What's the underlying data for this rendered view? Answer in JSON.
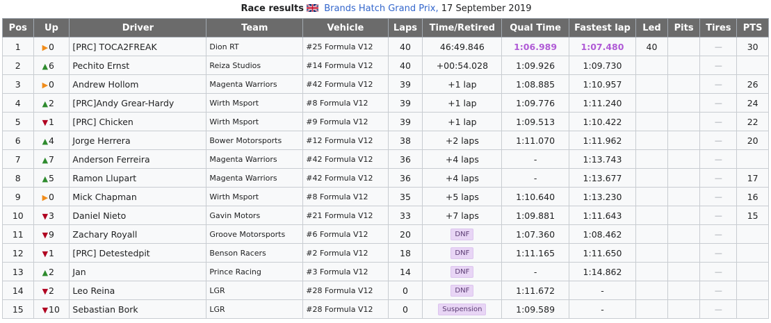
{
  "caption": {
    "prefix": "Race results",
    "event_link": "Brands Hatch Grand Prix,",
    "date": "17 September 2019",
    "flag_icon": "uk-flag-icon"
  },
  "colors": {
    "header_bg": "#6b6b6b",
    "up": "#2e8b2e",
    "down": "#b00020",
    "same": "#f08c1a",
    "fastest": "#b05bd6",
    "badge_bg": "#e8d5f5"
  },
  "headers": [
    "Pos",
    "Up",
    "Driver",
    "Team",
    "Vehicle",
    "Laps",
    "Time/Retired",
    "Qual Time",
    "Fastest lap",
    "Led",
    "Pits",
    "Tires",
    "PTS"
  ],
  "rows": [
    {
      "pos": "1",
      "dir": "same",
      "up": "0",
      "driver": "[PRC] TOCA2FREAK",
      "team": "Dion RT",
      "vehicle": "#25 Formula V12",
      "laps": "40",
      "time": "46:49.846",
      "status": "",
      "qual": "1:06.989",
      "qual_best": true,
      "fastest": "1:07.480",
      "fastest_best": true,
      "led": "40",
      "pits": "",
      "tires": "—",
      "pts": "30"
    },
    {
      "pos": "2",
      "dir": "up",
      "up": "6",
      "driver": "Pechito Ernst",
      "team": "Reiza Studios",
      "vehicle": "#14 Formula V12",
      "laps": "40",
      "time": "+00:54.028",
      "status": "",
      "qual": "1:09.926",
      "fastest": "1:09.730",
      "led": "",
      "pits": "",
      "tires": "—",
      "pts": ""
    },
    {
      "pos": "3",
      "dir": "same",
      "up": "0",
      "driver": "Andrew Hollom",
      "team": "Magenta Warriors",
      "vehicle": "#42 Formula V12",
      "laps": "39",
      "time": "+1 lap",
      "status": "",
      "qual": "1:08.885",
      "fastest": "1:10.957",
      "led": "",
      "pits": "",
      "tires": "—",
      "pts": "26"
    },
    {
      "pos": "4",
      "dir": "up",
      "up": "2",
      "driver": "[PRC]Andy Grear-Hardy",
      "team": "Wirth Msport",
      "vehicle": "#8 Formula V12",
      "laps": "39",
      "time": "+1 lap",
      "status": "",
      "qual": "1:09.776",
      "fastest": "1:11.240",
      "led": "",
      "pits": "",
      "tires": "—",
      "pts": "24"
    },
    {
      "pos": "5",
      "dir": "down",
      "up": "1",
      "driver": "[PRC] Chicken",
      "team": "Wirth Msport",
      "vehicle": "#9 Formula V12",
      "laps": "39",
      "time": "+1 lap",
      "status": "",
      "qual": "1:09.513",
      "fastest": "1:10.422",
      "led": "",
      "pits": "",
      "tires": "—",
      "pts": "22"
    },
    {
      "pos": "6",
      "dir": "up",
      "up": "4",
      "driver": "Jorge Herrera",
      "team": "Bower Motorsports",
      "vehicle": "#12 Formula V12",
      "laps": "38",
      "time": "+2 laps",
      "status": "",
      "qual": "1:11.070",
      "fastest": "1:11.962",
      "led": "",
      "pits": "",
      "tires": "—",
      "pts": "20"
    },
    {
      "pos": "7",
      "dir": "up",
      "up": "7",
      "driver": "Anderson Ferreira",
      "team": "Magenta Warriors",
      "vehicle": "#42 Formula V12",
      "laps": "36",
      "time": "+4 laps",
      "status": "",
      "qual": "-",
      "fastest": "1:13.743",
      "led": "",
      "pits": "",
      "tires": "—",
      "pts": ""
    },
    {
      "pos": "8",
      "dir": "up",
      "up": "5",
      "driver": "Ramon Llupart",
      "team": "Magenta Warriors",
      "vehicle": "#42 Formula V12",
      "laps": "36",
      "time": "+4 laps",
      "status": "",
      "qual": "-",
      "fastest": "1:13.677",
      "led": "",
      "pits": "",
      "tires": "—",
      "pts": "17"
    },
    {
      "pos": "9",
      "dir": "same",
      "up": "0",
      "driver": "Mick Chapman",
      "team": "Wirth Msport",
      "vehicle": "#8 Formula V12",
      "laps": "35",
      "time": "+5 laps",
      "status": "",
      "qual": "1:10.640",
      "fastest": "1:13.230",
      "led": "",
      "pits": "",
      "tires": "—",
      "pts": "16"
    },
    {
      "pos": "10",
      "dir": "down",
      "up": "3",
      "driver": "Daniel Nieto",
      "team": "Gavin Motors",
      "vehicle": "#21 Formula V12",
      "laps": "33",
      "time": "+7 laps",
      "status": "",
      "qual": "1:09.881",
      "fastest": "1:11.643",
      "led": "",
      "pits": "",
      "tires": "—",
      "pts": "15"
    },
    {
      "pos": "11",
      "dir": "down",
      "up": "9",
      "driver": "Zachary Royall",
      "team": "Groove Motorsports",
      "vehicle": "#6 Formula V12",
      "laps": "20",
      "time": "",
      "status": "DNF",
      "qual": "1:07.360",
      "fastest": "1:08.462",
      "led": "",
      "pits": "",
      "tires": "—",
      "pts": ""
    },
    {
      "pos": "12",
      "dir": "down",
      "up": "1",
      "driver": "[PRC] Detestedpit",
      "team": "Benson Racers",
      "vehicle": "#2 Formula V12",
      "laps": "18",
      "time": "",
      "status": "DNF",
      "qual": "1:11.165",
      "fastest": "1:11.650",
      "led": "",
      "pits": "",
      "tires": "—",
      "pts": ""
    },
    {
      "pos": "13",
      "dir": "up",
      "up": "2",
      "driver": "Jan",
      "team": "Prince Racing",
      "vehicle": "#3 Formula V12",
      "laps": "14",
      "time": "",
      "status": "DNF",
      "qual": "-",
      "fastest": "1:14.862",
      "led": "",
      "pits": "",
      "tires": "—",
      "pts": ""
    },
    {
      "pos": "14",
      "dir": "down",
      "up": "2",
      "driver": "Leo Reina",
      "team": "LGR",
      "vehicle": "#28 Formula V12",
      "laps": "0",
      "time": "",
      "status": "DNF",
      "qual": "1:11.672",
      "fastest": "-",
      "led": "",
      "pits": "",
      "tires": "—",
      "pts": ""
    },
    {
      "pos": "15",
      "dir": "down",
      "up": "10",
      "driver": "Sebastian Bork",
      "team": "LGR",
      "vehicle": "#28 Formula V12",
      "laps": "0",
      "time": "",
      "status": "Suspension",
      "qual": "1:09.589",
      "fastest": "-",
      "led": "",
      "pits": "",
      "tires": "—",
      "pts": ""
    }
  ]
}
